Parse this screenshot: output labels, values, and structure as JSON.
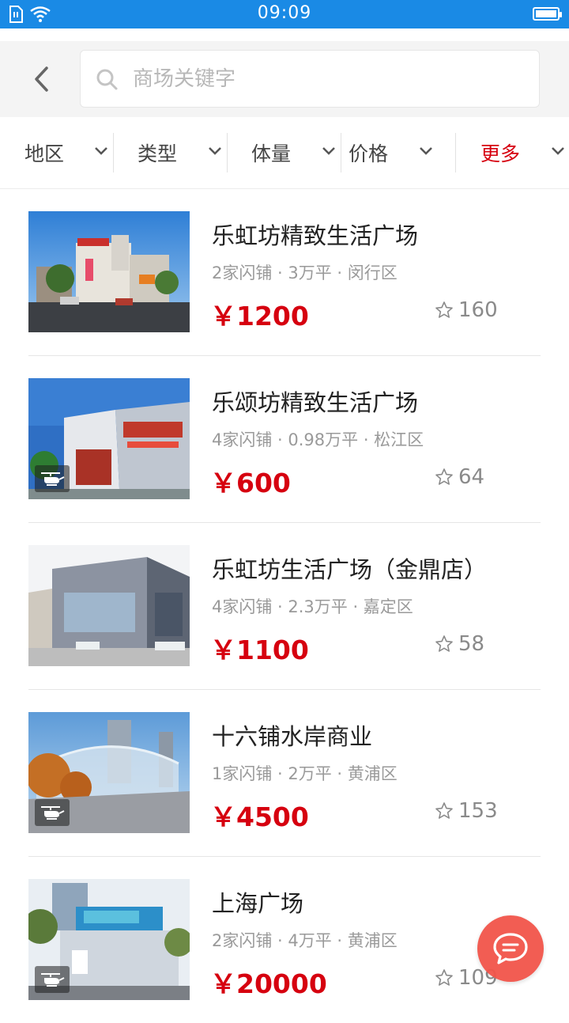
{
  "status_bar": {
    "time": "09:09"
  },
  "search": {
    "placeholder": "商场关键字",
    "value": ""
  },
  "filters": [
    {
      "label": "地区"
    },
    {
      "label": "类型"
    },
    {
      "label": "体量"
    },
    {
      "label": "价格"
    },
    {
      "label": "更多"
    }
  ],
  "colors": {
    "status_bar": "#1a8ae5",
    "price": "#d6000f",
    "accent_filter": "#d6000f",
    "chat_fab": "#f2554a"
  },
  "listings": [
    {
      "name": "乐虹坊精致生活广场",
      "meta": "2家闪铺 · 3万平 · 闵行区",
      "price": "￥1200",
      "favorites": "160",
      "has_drone_badge": false
    },
    {
      "name": "乐颂坊精致生活广场",
      "meta": "4家闪铺 · 0.98万平 · 松江区",
      "price": "￥600",
      "favorites": "64",
      "has_drone_badge": true
    },
    {
      "name": "乐虹坊生活广场（金鼎店）",
      "meta": "4家闪铺 · 2.3万平 · 嘉定区",
      "price": "￥1100",
      "favorites": "58",
      "has_drone_badge": false
    },
    {
      "name": "十六铺水岸商业",
      "meta": "1家闪铺 · 2万平 · 黄浦区",
      "price": "￥4500",
      "favorites": "153",
      "has_drone_badge": true
    },
    {
      "name": "上海广场",
      "meta": "2家闪铺 · 4万平 · 黄浦区",
      "price": "￥20000",
      "favorites": "109",
      "has_drone_badge": true
    }
  ],
  "icons": [
    "wifi-icon",
    "sim-icon",
    "battery-icon",
    "back-chevron-icon",
    "search-icon",
    "chevron-down-icon",
    "star-icon",
    "drone-icon",
    "chat-icon"
  ]
}
